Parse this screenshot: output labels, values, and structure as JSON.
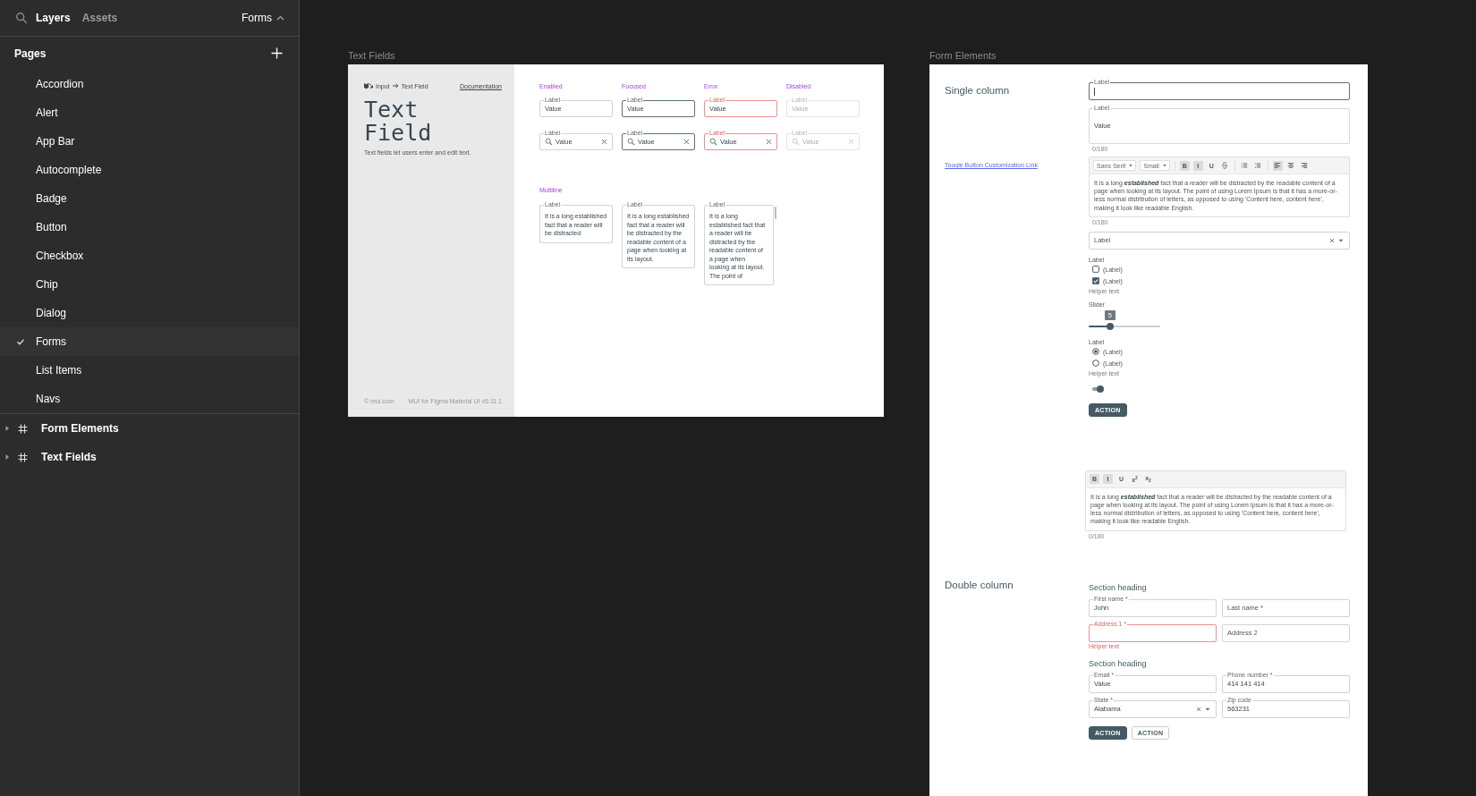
{
  "sidebar": {
    "tabs": [
      {
        "label": "Layers",
        "selected": true
      },
      {
        "label": "Assets",
        "selected": false
      }
    ],
    "page_menu": {
      "label": "Forms",
      "expanded": true
    },
    "pages_heading": "Pages",
    "pages": [
      {
        "label": "Accordion",
        "selected": false
      },
      {
        "label": "Alert",
        "selected": false
      },
      {
        "label": "App Bar",
        "selected": false
      },
      {
        "label": "Autocomplete",
        "selected": false
      },
      {
        "label": "Badge",
        "selected": false
      },
      {
        "label": "Button",
        "selected": false
      },
      {
        "label": "Checkbox",
        "selected": false
      },
      {
        "label": "Chip",
        "selected": false
      },
      {
        "label": "Dialog",
        "selected": false
      },
      {
        "label": "Forms",
        "selected": true
      },
      {
        "label": "List Items",
        "selected": false
      },
      {
        "label": "Navs",
        "selected": false
      }
    ],
    "layers": [
      {
        "label": "Form Elements",
        "expanded": false
      },
      {
        "label": "Text Fields",
        "expanded": false
      }
    ]
  },
  "canvas": {
    "frames": [
      {
        "kind": "text_fields",
        "title": "Text Fields",
        "intro": {
          "breadcrumb": [
            "Input",
            "Text Field"
          ],
          "link": "Documentation",
          "heading": "Text Field",
          "description": "Text fields let users enter and edit text.",
          "footer": [
            "© mui.com",
            "MUI for Figma Material UI v5.11.1"
          ]
        },
        "columns": [
          {
            "heading": "Enabled",
            "kind": "enabled",
            "fields": [
              {
                "kind": "text",
                "label": "Label",
                "value": "Value"
              },
              {
                "kind": "search",
                "label": "Label",
                "value": "Value"
              }
            ]
          },
          {
            "heading": "Focused",
            "kind": "focused",
            "fields": [
              {
                "kind": "text",
                "label": "Label",
                "value": "Value"
              },
              {
                "kind": "search",
                "label": "Label",
                "value": "Value"
              }
            ]
          },
          {
            "heading": "Error",
            "kind": "error",
            "fields": [
              {
                "kind": "text",
                "label": "Label",
                "value": "Value"
              },
              {
                "kind": "search",
                "label": "Label",
                "value": "Value"
              }
            ]
          },
          {
            "heading": "Disabled",
            "kind": "disabled",
            "fields": [
              {
                "kind": "text",
                "label": "Label",
                "value": "Value"
              },
              {
                "kind": "search",
                "label": "Label",
                "value": "Value"
              }
            ]
          }
        ],
        "multiline": {
          "heading": "Multiline",
          "fields": [
            {
              "label": "Label",
              "value": "It is a long established fact that a reader will be distracted",
              "scrollbar": false
            },
            {
              "label": "Label",
              "value": "It is a long established fact that a reader will be distracted by the readable content of a page when looking at its layout.",
              "scrollbar": false
            },
            {
              "label": "Label",
              "value": "It is a long established fact that a reader will be distracted by the readable content of a page when looking at its layout. The point of",
              "scrollbar": true
            }
          ]
        }
      },
      {
        "kind": "form_elements",
        "title": "Form Elements",
        "single_column": {
          "title": "Single column",
          "link": "Toogle Button Customization Link",
          "items": [
            {
              "kind": "text",
              "label": "Label",
              "focused": true
            },
            {
              "kind": "textarea",
              "label": "Label",
              "value": "Value",
              "counter": "0/180"
            },
            {
              "kind": "rich_editor",
              "font": "Sans Serif",
              "size": "Small",
              "tools": [
                {
                  "kind": "glyph",
                  "glyph": "B",
                  "selected": true
                },
                {
                  "kind": "glyph",
                  "glyph": "I",
                  "selected": true
                },
                {
                  "kind": "glyph",
                  "glyph": "U",
                  "selected": false
                },
                {
                  "kind": "strike",
                  "selected": false
                },
                {
                  "kind": "bullets",
                  "selected": false
                },
                {
                  "kind": "numbers",
                  "selected": false
                },
                {
                  "kind": "align-left",
                  "selected": true
                },
                {
                  "kind": "align-center",
                  "selected": false
                },
                {
                  "kind": "align-right",
                  "selected": false
                }
              ],
              "value": "It is a long **established** fact that a reader will be distracted by the readable content of a page when looking at its layout. The point of using Lorem Ipsum is that it has a more-or-less normal distribution of letters, as opposed to using 'Content here, content here', making it look like readable English.",
              "counter": "0/180"
            },
            {
              "kind": "select",
              "placeholder": "Label"
            },
            {
              "kind": "checkbox_group",
              "label": "Label",
              "options": [
                {
                  "label": "(Label)",
                  "checked": false
                },
                {
                  "label": "(Label)",
                  "checked": true
                }
              ],
              "helper": "Helper text"
            },
            {
              "kind": "slider",
              "label": "Slider",
              "reading": "5",
              "level": 0.3
            },
            {
              "kind": "radio_group",
              "label": "Label",
              "options": [
                {
                  "label": "(Label)",
                  "selected": true
                },
                {
                  "label": "(Label)",
                  "selected": false
                }
              ],
              "helper": "Helper text"
            },
            {
              "kind": "switch",
              "on": true
            },
            {
              "kind": "button",
              "label": "ACTION"
            }
          ]
        },
        "editor": {
          "tools": [
            {
              "kind": "glyph",
              "glyph": "B",
              "selected": true
            },
            {
              "kind": "glyph",
              "glyph": "I",
              "selected": true
            },
            {
              "kind": "glyph",
              "glyph": "U",
              "selected": false
            },
            {
              "kind": "glyph",
              "glyph": "x$^{2}$",
              "selected": false
            },
            {
              "kind": "glyph",
              "glyph": "x$_{2}$",
              "selected": false
            }
          ],
          "value": "It is a long **established** fact that a reader will be distracted by the readable content of a page when looking at its layout. The point of using Lorem Ipsum is that it has a more-or-less normal distribution of letters, as opposed to using 'Content here, content here', making it look like readable English.",
          "counter": "0/180"
        },
        "double_column": {
          "title": "Double column",
          "sections": [
            {
              "heading": "Section heading",
              "fields": [
                {
                  "kind": "text",
                  "label": "First name *",
                  "value": "John",
                  "error": false
                },
                {
                  "kind": "text",
                  "placeholder": "Last name *",
                  "error": false
                },
                {
                  "kind": "text",
                  "label": "Address 1 *",
                  "error": true,
                  "helper": "Helper text"
                },
                {
                  "kind": "text",
                  "placeholder": "Address 2",
                  "error": false
                }
              ]
            },
            {
              "heading": "Section heading",
              "fields": [
                {
                  "kind": "text",
                  "label": "Email *",
                  "value": "Value",
                  "error": false
                },
                {
                  "kind": "text",
                  "label": "Phone number *",
                  "value": "414 141 414",
                  "error": false
                },
                {
                  "kind": "select",
                  "label": "State *",
                  "value": "Alabama",
                  "error": false
                },
                {
                  "kind": "text",
                  "label": "Zip code",
                  "value": "563231",
                  "error": false
                }
              ]
            }
          ],
          "buttons": [
            {
              "label": "ACTION",
              "kind": "contained"
            },
            {
              "label": "ACTION",
              "kind": "outlined"
            }
          ]
        }
      }
    ]
  }
}
